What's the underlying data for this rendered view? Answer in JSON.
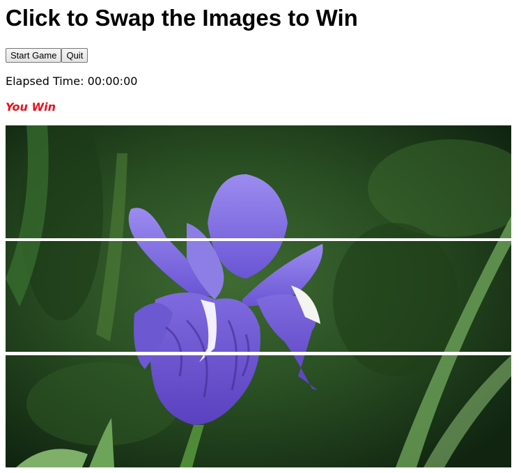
{
  "page": {
    "title": "Click to Swap the Images to Win",
    "buttons": {
      "start_label": "Start Game",
      "quit_label": "Quit"
    },
    "elapsed_time_text": "Elapsed Time: 00:00:00",
    "status_text": "You Win"
  },
  "board": {
    "piece_count": 3,
    "image_subject": "purple iris flower on green grass background"
  },
  "colors": {
    "status": "#e8101a"
  }
}
